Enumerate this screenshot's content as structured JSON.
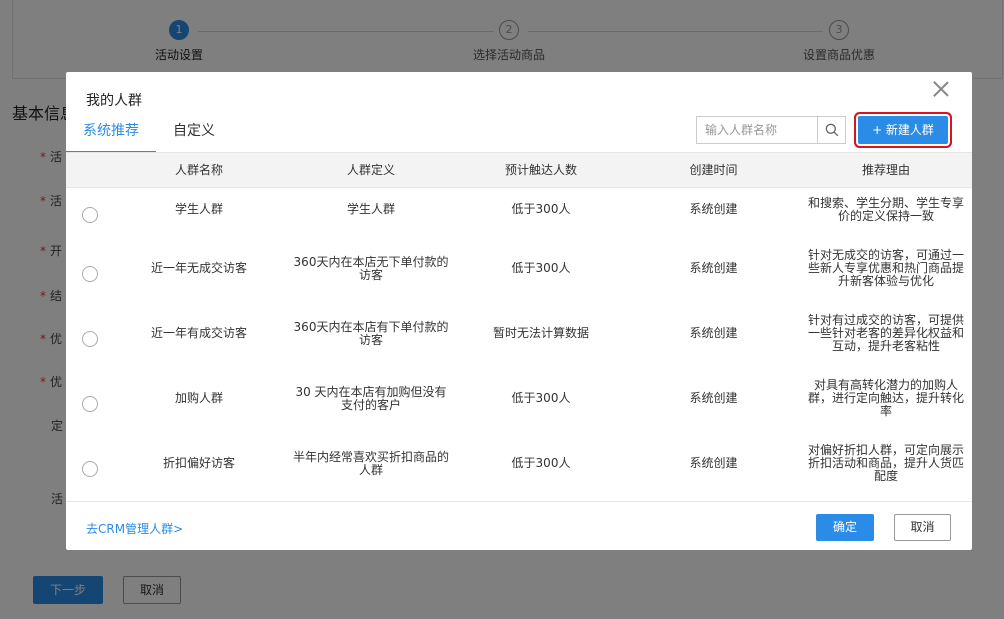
{
  "steps": [
    {
      "num": "1",
      "label": "活动设置"
    },
    {
      "num": "2",
      "label": "选择活动商品"
    },
    {
      "num": "3",
      "label": "设置商品优惠"
    }
  ],
  "page": {
    "section_title": "基本信息",
    "row_labels": [
      "活",
      "活",
      "开",
      "结",
      "优",
      "优",
      "定",
      "活"
    ],
    "next_label": "下一步",
    "cancel_label": "取消"
  },
  "modal": {
    "title": "我的人群",
    "tabs": [
      {
        "label": "系统推荐"
      },
      {
        "label": "自定义"
      }
    ],
    "search_placeholder": "输入人群名称",
    "new_button": "+ 新建人群",
    "columns": [
      "人群名称",
      "人群定义",
      "预计触达人数",
      "创建时间",
      "推荐理由"
    ],
    "rows": [
      {
        "name": "学生人群",
        "definition": "学生人群",
        "reach": "低于300人",
        "created": "系统创建",
        "reason": "和搜索、学生分期、学生专享价的定义保持一致"
      },
      {
        "name": "近一年无成交访客",
        "definition": "360天内在本店无下单付款的访客",
        "reach": "低于300人",
        "created": "系统创建",
        "reason": "针对无成交的访客，可通过一些新人专享优惠和热门商品提升新客体验与优化"
      },
      {
        "name": "近一年有成交访客",
        "definition": "360天内在本店有下单付款的访客",
        "reach": "暂时无法计算数据",
        "created": "系统创建",
        "reason": "针对有过成交的访客，可提供一些针对老客的差异化权益和互动，提升老客粘性"
      },
      {
        "name": "加购人群",
        "definition": "30 天内在本店有加购但没有支付的客户",
        "reach": "低于300人",
        "created": "系统创建",
        "reason": "对具有高转化潜力的加购人群，进行定向触达，提升转化率"
      },
      {
        "name": "折扣偏好访客",
        "definition": "半年内经常喜欢买折扣商品的人群",
        "reach": "低于300人",
        "created": "系统创建",
        "reason": "对偏好折扣人群，可定向展示折扣活动和商品，提升人货匹配度"
      }
    ],
    "crm_link": "去CRM管理人群>",
    "ok_label": "确定",
    "cancel_label": "取消"
  },
  "colors": {
    "primary": "#2a8ce6",
    "highlight": "#d9141b",
    "required": "#e33"
  }
}
